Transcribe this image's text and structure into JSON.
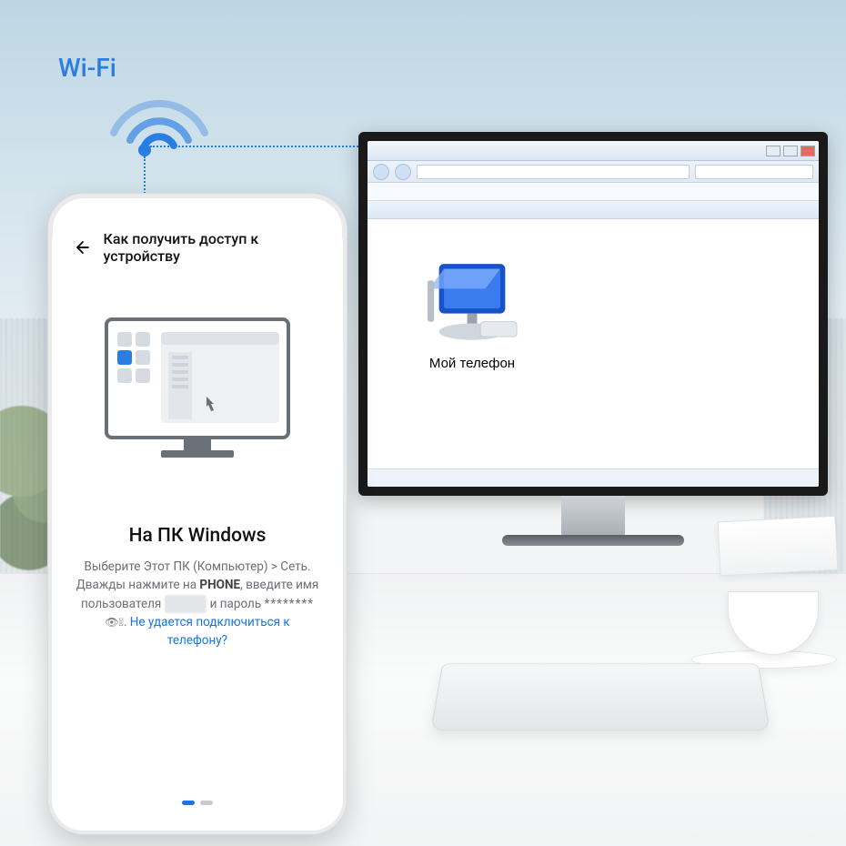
{
  "wifi": {
    "label": "Wi-Fi"
  },
  "phone": {
    "header_title": "Как получить доступ к устройству",
    "section_title": "На ПК Windows",
    "instruction_line1": "Выберите Этот ПК (Компьютер) > Сеть.",
    "instruction_line2_pre": "Дважды нажмите на ",
    "instruction_device_bold": "PHONE",
    "instruction_line2_post": ", введите имя",
    "instruction_line3_pre": "пользователя ",
    "username_masked": "hidden",
    "instruction_line3_mid": " и пароль ",
    "password_masked": "********",
    "instruction_line3_post": ". ",
    "help_link": "Не удается подключиться к телефону?",
    "pages": {
      "current": 1,
      "total": 2
    }
  },
  "monitor": {
    "device_label": "Мой телефон"
  }
}
